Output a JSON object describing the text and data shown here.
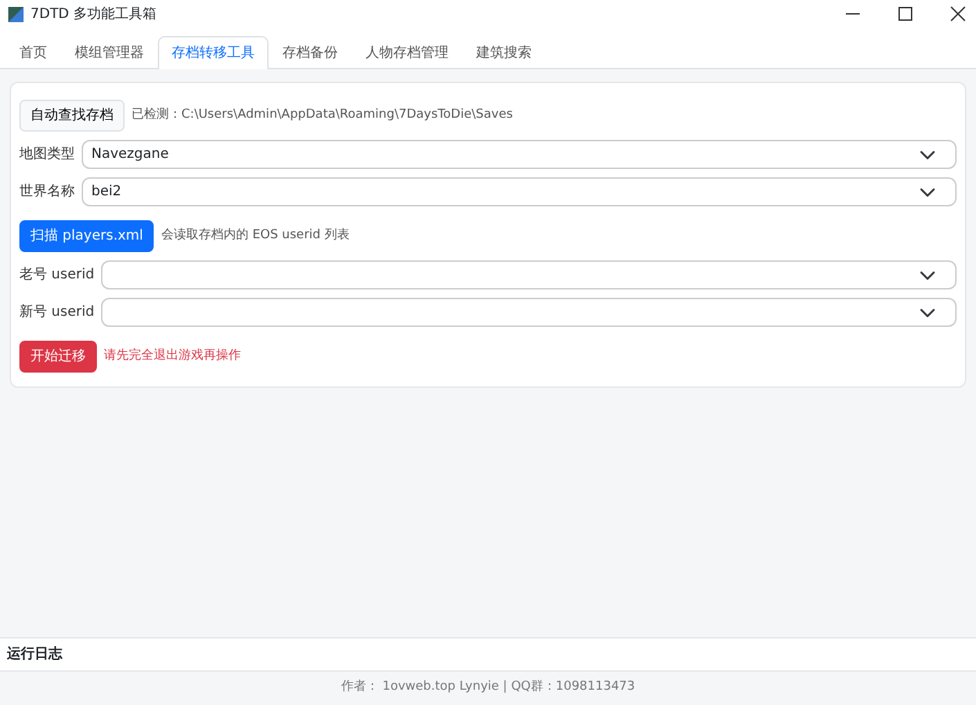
{
  "window": {
    "title": "7DTD 多功能工具箱"
  },
  "tabs": [
    {
      "label": "首页",
      "selected": false
    },
    {
      "label": "模组管理器",
      "selected": false
    },
    {
      "label": "存档转移工具",
      "selected": true
    },
    {
      "label": "存档备份",
      "selected": false
    },
    {
      "label": "人物存档管理",
      "selected": false
    },
    {
      "label": "建筑搜索",
      "selected": false
    }
  ],
  "auto_find": {
    "button": "自动查找存档",
    "detected": "已检测：C:\\Users\\Admin\\AppData\\Roaming\\7DaysToDie\\Saves"
  },
  "map_type": {
    "label": "地图类型",
    "value": "Navezgane"
  },
  "world_name": {
    "label": "世界名称",
    "value": "bei2"
  },
  "scan": {
    "button": "扫描 players.xml",
    "hint": "会读取存档内的 EOS userid 列表"
  },
  "old_userid": {
    "label": "老号 userid"
  },
  "new_userid": {
    "label": "新号 userid"
  },
  "start": {
    "button": "开始迁移",
    "warning": "请先完全退出游戏再操作"
  },
  "log": {
    "title": "运行日志"
  },
  "footer": "作者： 1ovweb.top Lynyie  |  QQ群：1098113473"
}
